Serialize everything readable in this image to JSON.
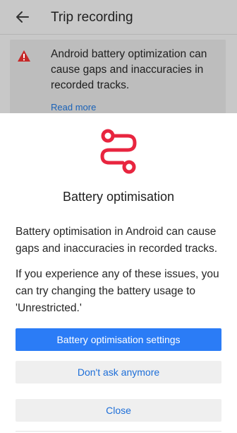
{
  "appbar": {
    "title": "Trip recording",
    "back_icon": "arrow-left-icon"
  },
  "warning": {
    "icon": "warning-triangle-icon",
    "text": "Android battery optimization can cause gaps and inaccuracies in recorded tracks.",
    "link": "Read more"
  },
  "dialog": {
    "icon": "route-icon",
    "title": "Battery optimisation",
    "paragraph1": "Battery optimisation in Android can cause gaps and inaccuracies in recorded tracks.",
    "paragraph2": "If you experience any of these issues, you can try changing the battery usage to 'Unrestricted.'",
    "buttons": {
      "primary": "Battery optimisation settings",
      "dont_ask": "Don't ask anymore",
      "close": "Close"
    }
  },
  "colors": {
    "primary": "#2b7cf6",
    "accent_red": "#e8253f",
    "warning_red": "#c62828",
    "link_blue": "#1d6ed8"
  }
}
